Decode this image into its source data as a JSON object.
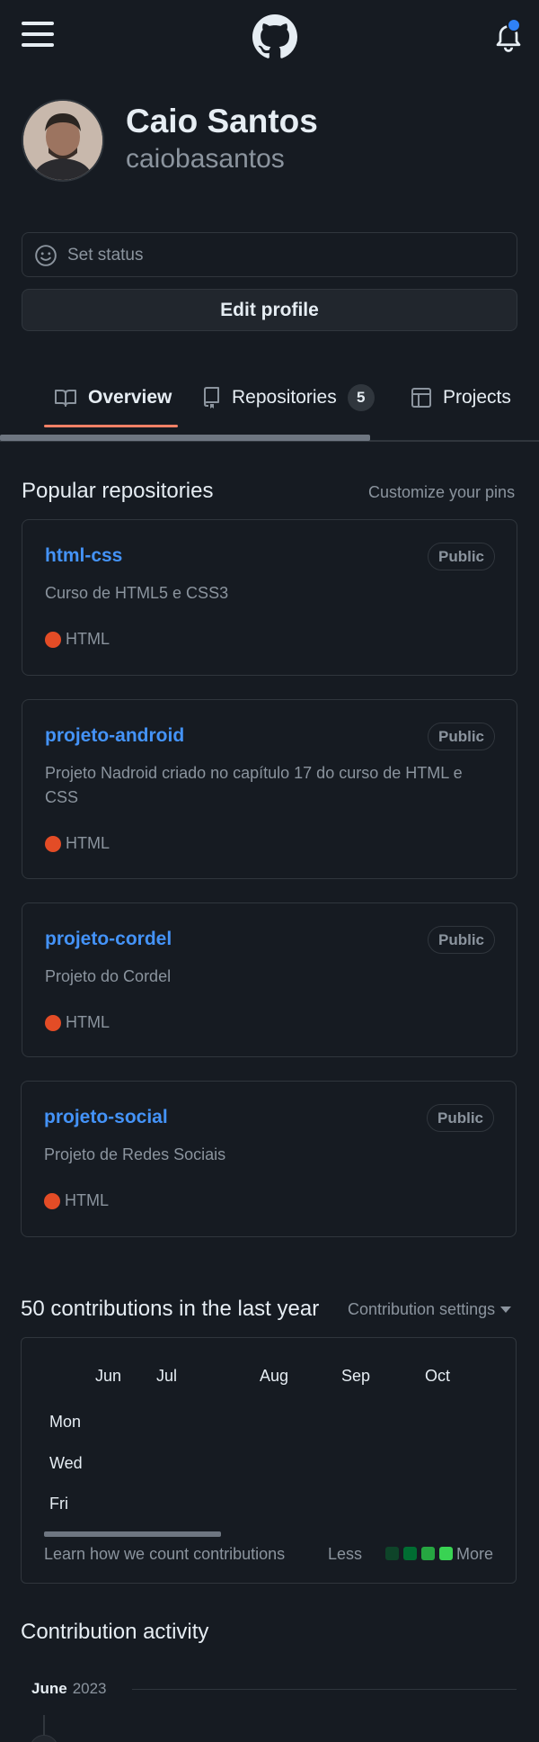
{
  "header": {
    "menu_icon": "hamburger-icon",
    "logo_icon": "github-mark-icon",
    "notification_icon": "bell-icon",
    "notification_dot_color": "#2f81f7"
  },
  "profile": {
    "full_name": "Caio Santos",
    "username": "caiobasantos",
    "status_label": "Set status",
    "status_icon": "smiley-icon",
    "edit_label": "Edit profile"
  },
  "tabs": [
    {
      "label": "Overview",
      "icon": "book-icon",
      "selected": true
    },
    {
      "label": "Repositories",
      "icon": "repo-icon",
      "count": "5"
    },
    {
      "label": "Projects",
      "icon": "table-icon"
    }
  ],
  "popular": {
    "title": "Popular repositories",
    "customize_label": "Customize your pins",
    "repos": [
      {
        "name": "html-css",
        "visibility": "Public",
        "description": "Curso de HTML5 e CSS3",
        "language": "HTML",
        "language_color": "#e34c26"
      },
      {
        "name": "projeto-android",
        "visibility": "Public",
        "description": "Projeto Nadroid criado no capítulo 17 do curso de HTML e CSS",
        "language": "HTML",
        "language_color": "#e34c26"
      },
      {
        "name": "projeto-cordel",
        "visibility": "Public",
        "description": "Projeto do Cordel",
        "language": "HTML",
        "language_color": "#e34c26"
      },
      {
        "name": "projeto-social",
        "visibility": "Public",
        "description": "Projeto de Redes Sociais",
        "language": "HTML",
        "language_color": "#e34c26"
      }
    ]
  },
  "contributions": {
    "title": "50 contributions in the last year",
    "settings_label": "Contribution settings",
    "months": [
      "Jun",
      "Jul",
      "Aug",
      "Sep",
      "Oct"
    ],
    "weekdays": [
      "Mon",
      "Wed",
      "Fri"
    ],
    "learn_label": "Learn how we count contributions",
    "legend_less": "Less",
    "legend_more": "More",
    "legend_colors": [
      "#0e4429",
      "#006d32",
      "#26a641",
      "#39d353"
    ]
  },
  "activity": {
    "title": "Contribution activity",
    "month": "June",
    "year": "2023"
  }
}
